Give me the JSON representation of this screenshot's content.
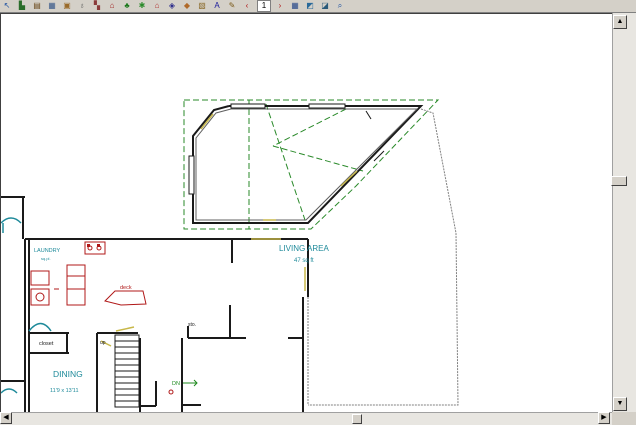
{
  "toolbar": {
    "buttons": [
      {
        "name": "select-arrow-icon",
        "glyph": "↖",
        "color": "#1a4fa0"
      },
      {
        "name": "open-door-icon",
        "glyph": "▙",
        "color": "#2a6d2a"
      },
      {
        "name": "wall-icon",
        "glyph": "▤",
        "color": "#6b4a1c"
      },
      {
        "name": "window-icon",
        "glyph": "▦",
        "color": "#3a5a8a"
      },
      {
        "name": "cabinet-icon",
        "glyph": "▣",
        "color": "#9a6b2a"
      },
      {
        "name": "fixture-icon",
        "glyph": "♁",
        "color": "#555555"
      },
      {
        "name": "stairs-icon",
        "glyph": "▚",
        "color": "#8a3b3b"
      },
      {
        "name": "furniture-icon",
        "glyph": "⌂",
        "color": "#a02020"
      },
      {
        "name": "tree-icon",
        "glyph": "♣",
        "color": "#1f7a1f"
      },
      {
        "name": "palm-icon",
        "glyph": "✱",
        "color": "#2a8a2a"
      },
      {
        "name": "house-icon",
        "glyph": "⌂",
        "color": "#b03030"
      },
      {
        "name": "paint-bucket-icon",
        "glyph": "◈",
        "color": "#2a2a8a"
      },
      {
        "name": "eraser-icon",
        "glyph": "◆",
        "color": "#b06a2a"
      },
      {
        "name": "material-icon",
        "glyph": "▧",
        "color": "#8a6a2a"
      },
      {
        "name": "text-icon",
        "glyph": "A",
        "color": "#1a1a9a"
      },
      {
        "name": "pencil-icon",
        "glyph": "✎",
        "color": "#7a5a1a"
      }
    ],
    "page_prev": "‹",
    "page_number": "1",
    "page_next": "›",
    "right_buttons": [
      {
        "name": "plan-view-icon",
        "glyph": "▦",
        "color": "#2a4a8a"
      },
      {
        "name": "camera-view-icon",
        "glyph": "◩",
        "color": "#2a6a9a"
      },
      {
        "name": "elevation-view-icon",
        "glyph": "◪",
        "color": "#2a5a7a"
      },
      {
        "name": "zoom-icon",
        "glyph": "⌕",
        "color": "#1a4fa0"
      }
    ]
  },
  "plan": {
    "rooms": {
      "living_area": {
        "name": "LIVING AREA",
        "area": "47 sq ft"
      },
      "laundry": {
        "name": "LAUNDRY",
        "sub": "sq.pl."
      },
      "dining": {
        "name": "DINING",
        "dims": "11'9 x 13'11"
      },
      "deck": "deck",
      "closet": "closet",
      "sto": "sto.",
      "up": "up",
      "dn": "DN"
    }
  },
  "colors": {
    "wall": "#1a1a1a",
    "dashed_green": "#2a8a2a",
    "label_teal": "#1e8a9a",
    "fixture_red": "#b01818",
    "door_yellow": "#c8b84a"
  }
}
